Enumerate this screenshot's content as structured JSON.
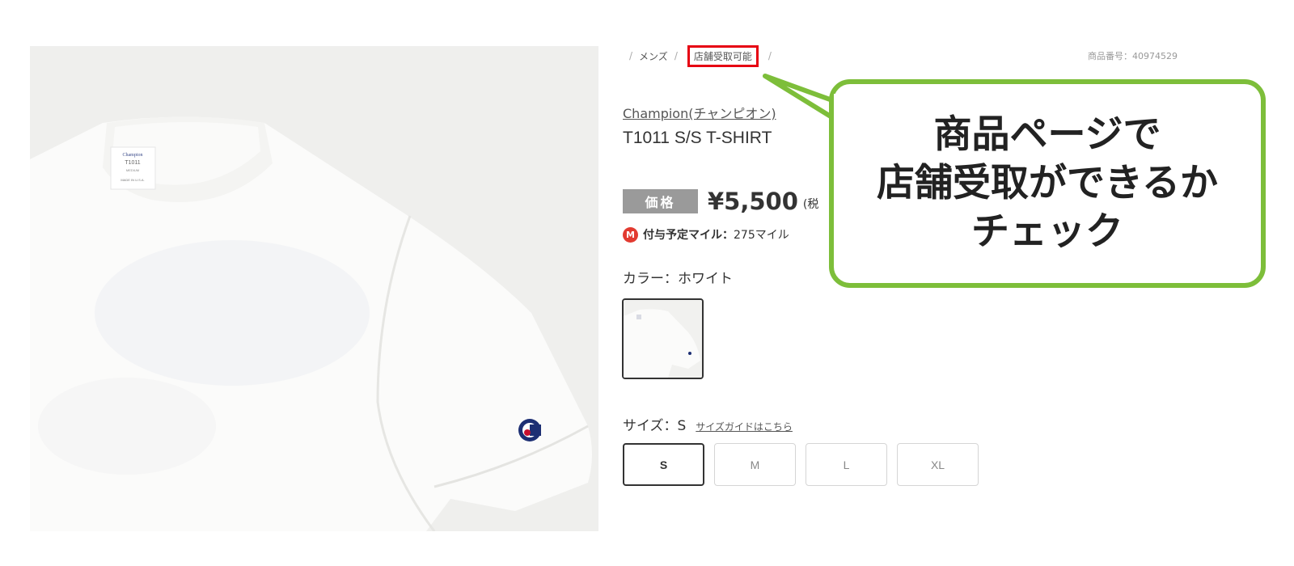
{
  "breadcrumb": {
    "sep": "/",
    "items": [
      {
        "label": "メンズ",
        "highlighted": false
      },
      {
        "label": "店舗受取可能",
        "highlighted": true
      }
    ]
  },
  "product": {
    "code": "商品番号：40974529",
    "brand": "Champion(チャンピオン)",
    "name": "T1011 S/S T-SHIRT",
    "photo": {
      "tag_lines": [
        "Champion",
        "T1011",
        "MEDIUM",
        "MADE IN U.S.A."
      ]
    }
  },
  "price": {
    "label": "価格",
    "value": "¥5,500",
    "tax_note": "(税"
  },
  "mile": {
    "badge": "M",
    "label": "付与予定マイル：",
    "value": "275マイル"
  },
  "color": {
    "label": "カラー：ホワイト",
    "selected": "ホワイト"
  },
  "size": {
    "label": "サイズ：S",
    "guide_link": "サイズガイドはこちら",
    "options": [
      "S",
      "M",
      "L",
      "XL"
    ],
    "selected": "S"
  },
  "callout": {
    "lines": [
      "商品ページで",
      "店舗受取ができるか",
      "チェック"
    ]
  },
  "colors": {
    "callout_border": "#7dbe3a",
    "highlight_border": "#e60012",
    "price_label_bg": "#9a9a9a",
    "mile_badge": "#e23a30"
  }
}
